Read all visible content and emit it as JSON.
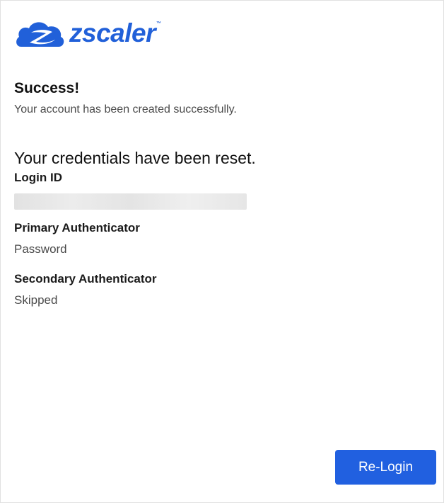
{
  "brand": {
    "name": "zscaler",
    "trademark": "™",
    "color": "#2160d9",
    "logo_icon": "zscaler-cloud-icon"
  },
  "success": {
    "title": "Success!",
    "message": "Your account has been created successfully."
  },
  "credentials": {
    "heading": "Your credentials have been reset.",
    "login_id_label": "Login ID",
    "login_id_value_redacted": true,
    "primary_label": "Primary Authenticator",
    "primary_value": "Password",
    "secondary_label": "Secondary Authenticator",
    "secondary_value": "Skipped"
  },
  "actions": {
    "relogin_label": "Re-Login",
    "button_color": "#2160e0"
  }
}
